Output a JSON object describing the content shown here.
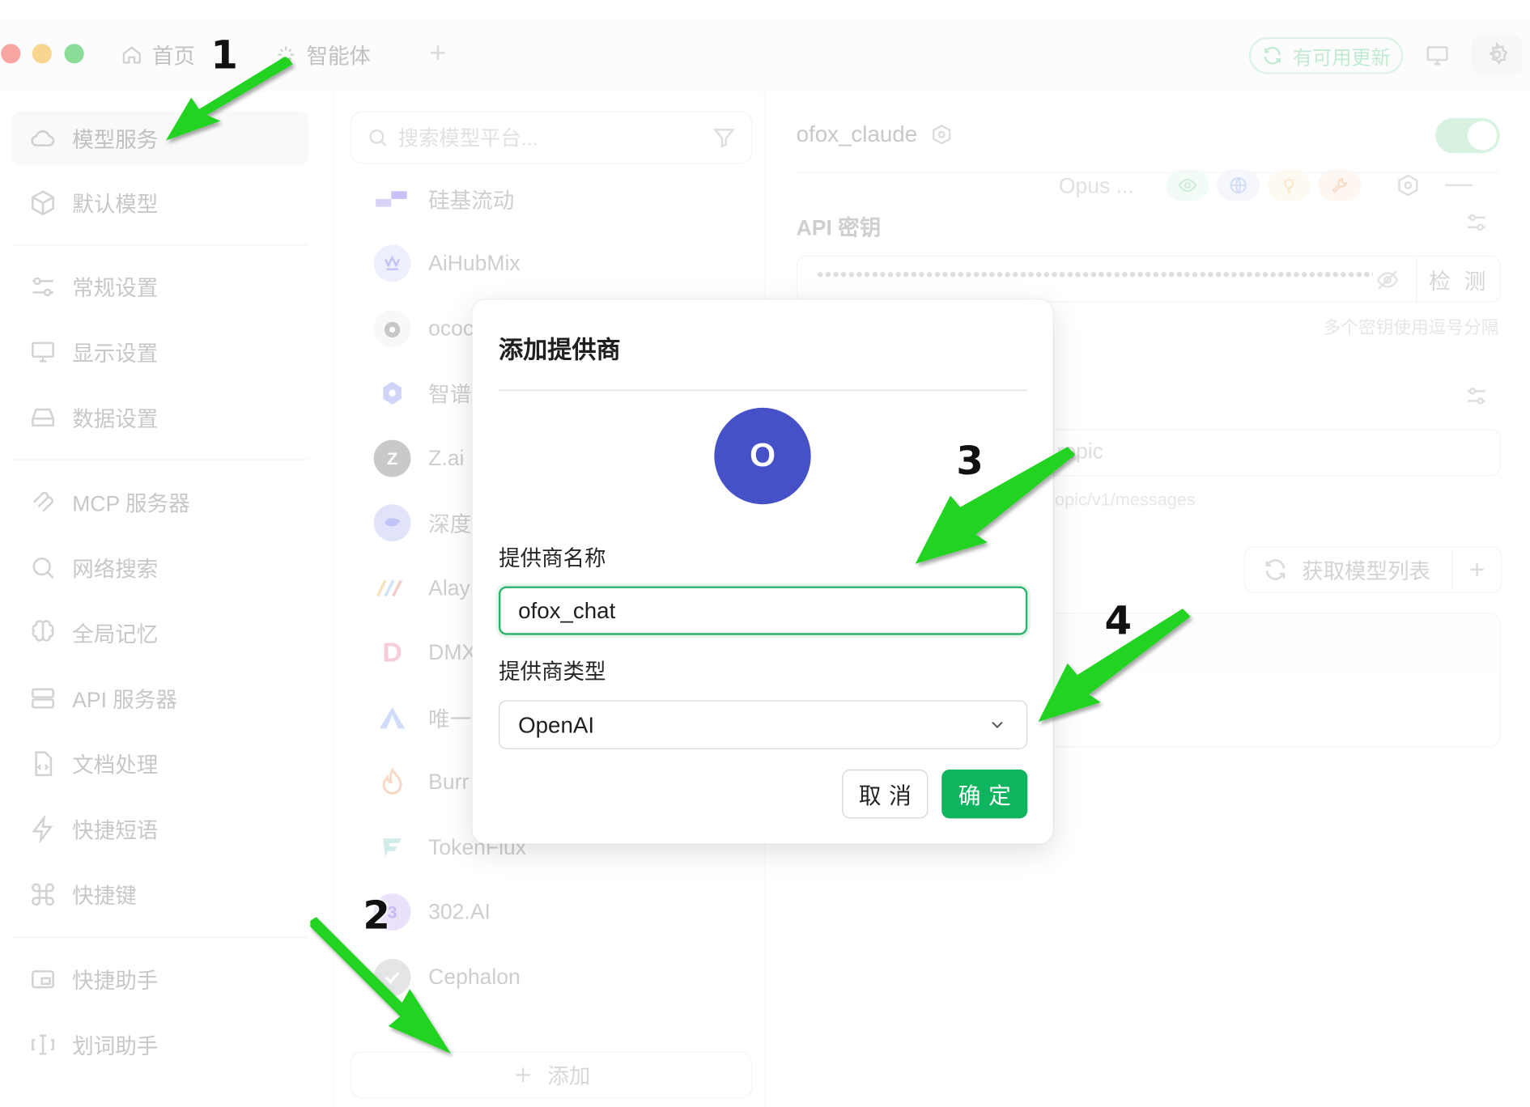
{
  "titlebar": {
    "tabs": [
      {
        "label": "首页",
        "icon": "home-icon"
      },
      {
        "label": "智能体",
        "icon": "sparkle-icon"
      }
    ],
    "new_tab": "+",
    "update_label": "有可用更新"
  },
  "nav": {
    "items": [
      {
        "label": "模型服务",
        "icon": "cloud-icon",
        "active": true
      },
      {
        "label": "默认模型",
        "icon": "cube-icon"
      },
      {
        "label": "常规设置",
        "icon": "sliders-icon"
      },
      {
        "label": "显示设置",
        "icon": "monitor-icon"
      },
      {
        "label": "数据设置",
        "icon": "drive-icon"
      },
      {
        "label": "MCP 服务器",
        "icon": "mcp-icon"
      },
      {
        "label": "网络搜索",
        "icon": "search-icon"
      },
      {
        "label": "全局记忆",
        "icon": "brain-icon"
      },
      {
        "label": "API 服务器",
        "icon": "server-icon"
      },
      {
        "label": "文档处理",
        "icon": "file-code-icon"
      },
      {
        "label": "快捷短语",
        "icon": "zap-icon"
      },
      {
        "label": "快捷键",
        "icon": "command-icon"
      },
      {
        "label": "快捷助手",
        "icon": "window-icon"
      },
      {
        "label": "划词助手",
        "icon": "text-cursor-icon"
      }
    ]
  },
  "providers": {
    "search_placeholder": "搜索模型平台...",
    "items": [
      {
        "label": "硅基流动",
        "color": "#8d7ee6"
      },
      {
        "label": "AiHubMix",
        "color": "#6f76e8"
      },
      {
        "label": "ococ",
        "color": "#333333"
      },
      {
        "label": "智谱",
        "color": "#4f5ce0"
      },
      {
        "label": "Z.ai",
        "color": "#2b2b2b"
      },
      {
        "label": "深度",
        "color": "#5b6ef0"
      },
      {
        "label": "Alay",
        "color": "#e0a340"
      },
      {
        "label": "DMX",
        "color": "#e04a7a"
      },
      {
        "label": "唯一",
        "color": "#3d6cf0"
      },
      {
        "label": "Burr",
        "color": "#f07a3c"
      },
      {
        "label": "TokenFlux",
        "color": "#2fa7a0"
      },
      {
        "label": "302.AI",
        "color": "#8a5cf0"
      },
      {
        "label": "Cephalon",
        "color": "#333333"
      }
    ],
    "add_label": "添加"
  },
  "detail": {
    "provider_name": "ofox_claude",
    "api_key_label": "API 密钥",
    "api_key_value": "••••••••••••••••••••••••••••••••••••••••••••••••••••••••••••••••••••••••••••••••",
    "check_label": "检 测",
    "key_hint": "多个密钥使用逗号分隔",
    "api_url_value": "ropic",
    "api_url_hint": "opic/v1/messages",
    "fetch_label": "获取模型列表",
    "fetch_plus": "+",
    "model_name": "Opus ...",
    "model_minus": "—",
    "colors": {
      "cap_eye": "#2bb673",
      "cap_globe": "#4a7bd8",
      "cap_bulb": "#e8b23a",
      "cap_tool": "#e8833a"
    }
  },
  "modal": {
    "title": "添加提供商",
    "avatar_letter": "O",
    "name_label": "提供商名称",
    "name_value": "ofox_chat",
    "type_label": "提供商类型",
    "type_value": "OpenAI",
    "cancel_label": "取消",
    "ok_label": "确定",
    "accent": "#0fb45f",
    "avatar_color": "#4651c8"
  },
  "annotations": {
    "steps": [
      "1",
      "2",
      "3",
      "4"
    ],
    "arrow_color": "#22d322"
  }
}
